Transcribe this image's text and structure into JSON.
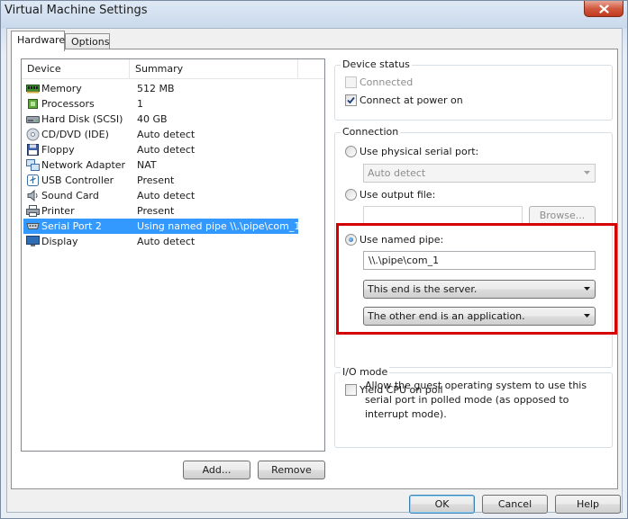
{
  "window": {
    "title": "Virtual Machine Settings"
  },
  "tabs": [
    {
      "label": "Hardware",
      "active": true
    },
    {
      "label": "Options",
      "active": false
    }
  ],
  "device_list": {
    "columns": [
      "Device",
      "Summary"
    ],
    "rows": [
      {
        "name": "Memory",
        "summary": "512 MB",
        "icon": "memory-icon",
        "selected": false
      },
      {
        "name": "Processors",
        "summary": "1",
        "icon": "processor-icon",
        "selected": false
      },
      {
        "name": "Hard Disk (SCSI)",
        "summary": "40 GB",
        "icon": "hard-disk-icon",
        "selected": false
      },
      {
        "name": "CD/DVD (IDE)",
        "summary": "Auto detect",
        "icon": "cd-dvd-icon",
        "selected": false
      },
      {
        "name": "Floppy",
        "summary": "Auto detect",
        "icon": "floppy-icon",
        "selected": false
      },
      {
        "name": "Network Adapter",
        "summary": "NAT",
        "icon": "network-adapter-icon",
        "selected": false
      },
      {
        "name": "USB Controller",
        "summary": "Present",
        "icon": "usb-icon",
        "selected": false
      },
      {
        "name": "Sound Card",
        "summary": "Auto detect",
        "icon": "sound-card-icon",
        "selected": false
      },
      {
        "name": "Printer",
        "summary": "Present",
        "icon": "printer-icon",
        "selected": false
      },
      {
        "name": "Serial Port 2",
        "summary": "Using named pipe \\\\.\\pipe\\com_1",
        "icon": "serial-port-icon",
        "selected": true
      },
      {
        "name": "Display",
        "summary": "Auto detect",
        "icon": "display-icon",
        "selected": false
      }
    ],
    "add_label": "Add...",
    "remove_label": "Remove"
  },
  "device_status": {
    "title": "Device status",
    "connected": {
      "label": "Connected",
      "checked": false,
      "disabled": true
    },
    "connect_at_power_on": {
      "label": "Connect at power on",
      "checked": true
    }
  },
  "connection": {
    "title": "Connection",
    "physical": {
      "label": "Use physical serial port:",
      "selected": false,
      "combo_value": "Auto detect"
    },
    "output_file": {
      "label": "Use output file:",
      "selected": false,
      "value": "",
      "browse_label": "Browse..."
    },
    "named_pipe": {
      "label": "Use named pipe:",
      "selected": true,
      "value": "\\\\.\\pipe\\com_1",
      "end_option": "This end is the server.",
      "other_end_option": "The other end is an application."
    }
  },
  "io_mode": {
    "title": "I/O mode",
    "yield_cpu": {
      "label": "Yield CPU on poll",
      "checked": false
    },
    "description": "Allow the guest operating system to use this serial port in polled mode (as opposed to interrupt mode)."
  },
  "footer": {
    "ok_label": "OK",
    "cancel_label": "Cancel",
    "help_label": "Help"
  },
  "colors": {
    "selection": "#3399ff",
    "highlight_box": "#d40000"
  }
}
